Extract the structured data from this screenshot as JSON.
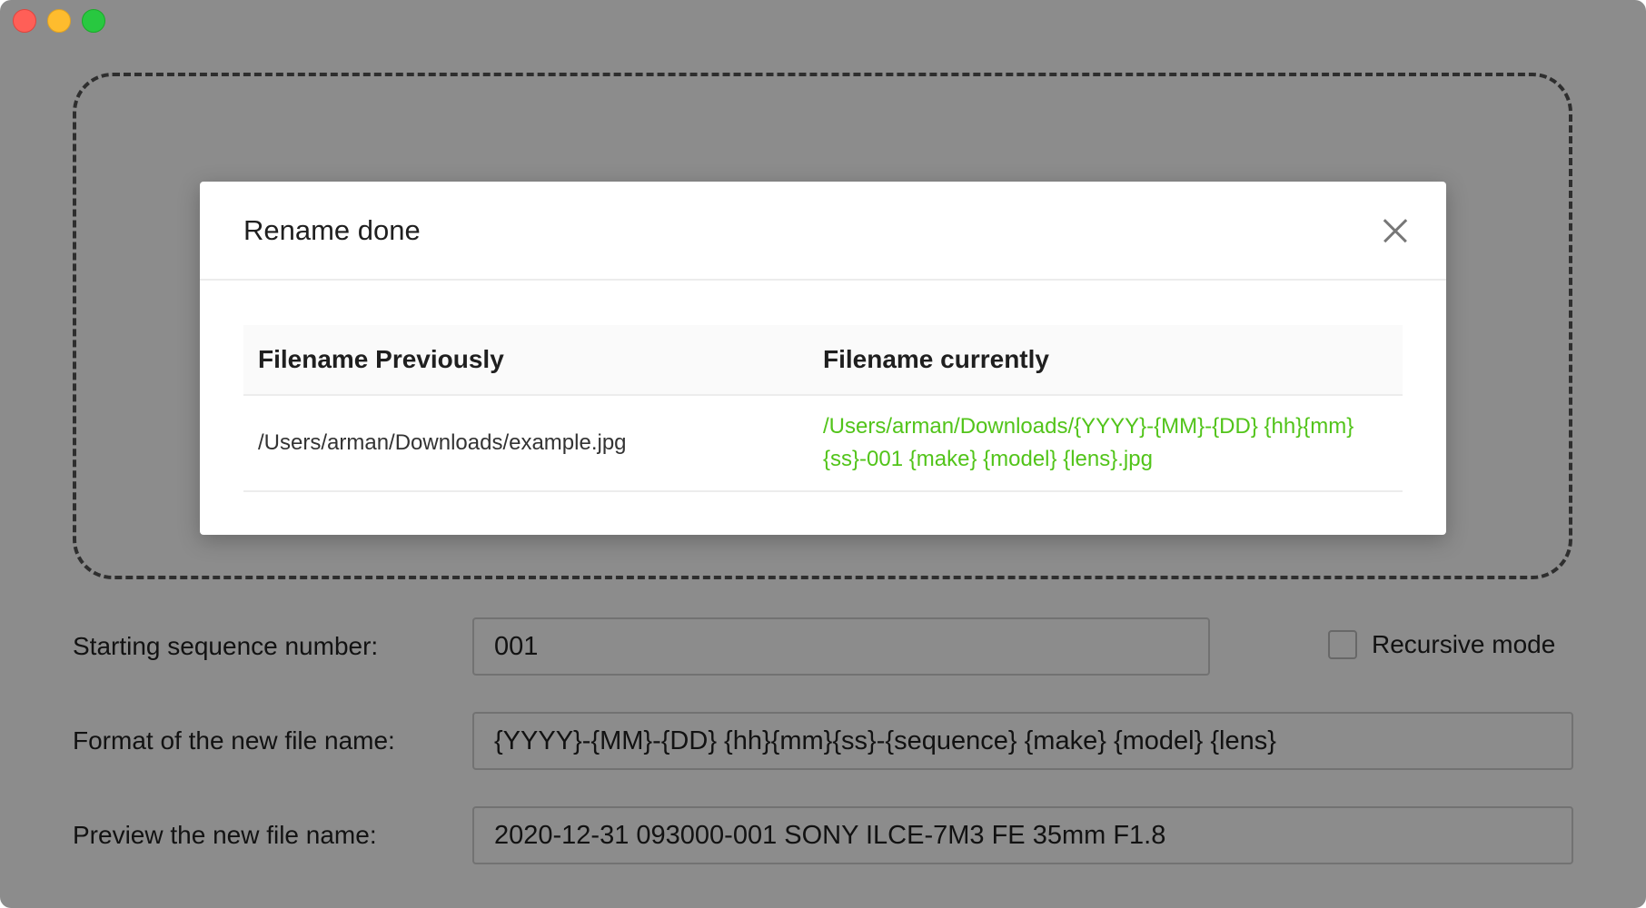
{
  "window": {
    "controls": [
      "close",
      "minimize",
      "zoom"
    ]
  },
  "form": {
    "sequence_label": "Starting sequence number:",
    "sequence_value": "001",
    "recursive_label": "Recursive mode",
    "recursive_checked": false,
    "format_label": "Format of the new file name:",
    "format_value": "{YYYY}-{MM}-{DD} {hh}{mm}{ss}-{sequence} {make} {model} {lens}",
    "preview_label": "Preview the new file name:",
    "preview_value": "2020-12-31 093000-001 SONY ILCE-7M3 FE 35mm F1.8"
  },
  "modal": {
    "title": "Rename done",
    "close_icon": "close-icon",
    "columns": [
      "Filename Previously",
      "Filename currently"
    ],
    "rows": [
      {
        "previous": "/Users/arman/Downloads/example.jpg",
        "current": "/Users/arman/Downloads/{YYYY}-{MM}-{DD} {hh}{mm}{ss}-001 {make} {model} {lens}.jpg"
      }
    ]
  },
  "colors": {
    "success_text": "#52c41a",
    "overlay": "rgba(0,0,0,0.45)"
  }
}
